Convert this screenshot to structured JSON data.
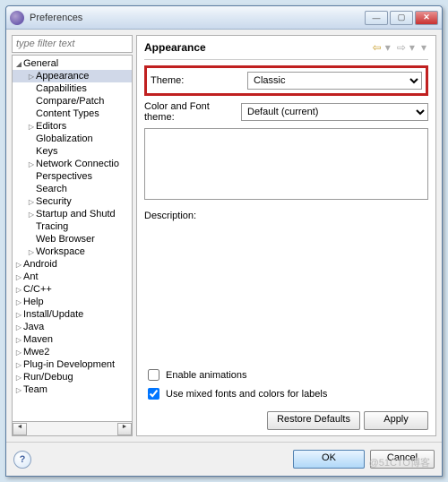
{
  "window": {
    "title": "Preferences"
  },
  "filter": {
    "placeholder": "type filter text"
  },
  "tree": {
    "general": "General",
    "items_l2": [
      "Appearance",
      "Capabilities",
      "Compare/Patch",
      "Content Types",
      "Editors",
      "Globalization",
      "Keys",
      "Network Connectio",
      "Perspectives",
      "Search",
      "Security",
      "Startup and Shutd",
      "Tracing",
      "Web Browser",
      "Workspace"
    ],
    "items_l1": [
      "Android",
      "Ant",
      "C/C++",
      "Help",
      "Install/Update",
      "Java",
      "Maven",
      "Mwe2",
      "Plug-in Development",
      "Run/Debug",
      "Team"
    ]
  },
  "page": {
    "title": "Appearance",
    "theme_label": "Theme:",
    "theme_value": "Classic",
    "colorfont_label": "Color and Font theme:",
    "colorfont_value": "Default (current)",
    "description_label": "Description:",
    "chk_anim": "Enable animations",
    "chk_fonts": "Use mixed fonts and colors for labels",
    "restore": "Restore Defaults",
    "apply": "Apply"
  },
  "footer": {
    "ok": "OK",
    "cancel": "Cancel"
  },
  "watermark": "@51CTO博客"
}
